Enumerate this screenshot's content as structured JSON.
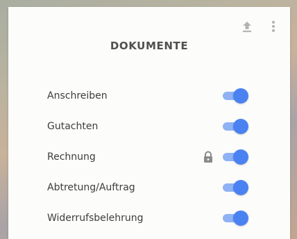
{
  "dialog": {
    "title": "DOKUMENTE",
    "actions": [
      {
        "name": "upload-icon"
      },
      {
        "name": "more-vertical-icon"
      }
    ]
  },
  "documents": [
    {
      "label": "Anschreiben",
      "enabled": true,
      "locked": false
    },
    {
      "label": "Gutachten",
      "enabled": true,
      "locked": false
    },
    {
      "label": "Rechnung",
      "enabled": true,
      "locked": true
    },
    {
      "label": "Abtretung/Auftrag",
      "enabled": true,
      "locked": false
    },
    {
      "label": "Widerrufsbelehrung",
      "enabled": true,
      "locked": false
    }
  ],
  "colors": {
    "toggle_track": "#8fb2f5",
    "toggle_knob": "#4a82f2",
    "icon_gray": "#b3b3b3",
    "lock_gray": "#8a8a8a"
  }
}
